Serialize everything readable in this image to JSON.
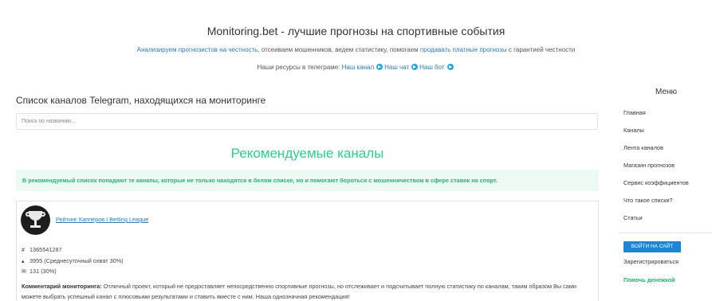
{
  "header": {
    "title": "Monitoring.bet - лучшие прогнозы на спортивные события",
    "subtitle": {
      "link1": "Анализируем прогнозистов на честность",
      "text1": ", отсеиваем мошенников, ведем статистику, помогаем ",
      "link2": "продавать платные прогнозы",
      "text2": " с гарантией честности"
    },
    "resources": {
      "label": "Наши ресурсы в телеграме:",
      "channel": "Наш канал",
      "chat": "Наш чат",
      "bot": "Наш бот"
    }
  },
  "main": {
    "page_title": "Список каналов Telegram, находящихся на мониторинге",
    "search_placeholder": "Поиск по названию...",
    "recommended_heading": "Рекомендуемые каналы",
    "alert_text": "В рекомендуемый список попадают те каналы, которые не только находятся в белом списке, но и помогают бороться с мошенничеством в сфере ставок на спорт.",
    "card": {
      "channel_name": "Рейтинг Капперов I Betting League",
      "stat_id": "1365541287",
      "stat_reach": "3955 (Среднесуточный охват 30%)",
      "stat_posts": "131 (30%)",
      "comment_label": "Комментарий мониторинга:",
      "comment_text": " Отличный проект, который не предоставляет непосредственно спортивные прогнозы, но отслеживает и подсчитывает полную статистику по каналам, таким образом Вы сами можете выбрать успешный канал с плюсовыми результатами и ставить вместе с ним. Наша однозначная рекомендация!"
    }
  },
  "sidebar": {
    "title": "Меню",
    "items": [
      {
        "label": "Главная"
      },
      {
        "label": "Каналы"
      },
      {
        "label": "Лента каналов"
      },
      {
        "label": "Магазин прогнозов"
      },
      {
        "label": "Сервис коэффициентов"
      },
      {
        "label": "Что такое списки?"
      },
      {
        "label": "Статьи"
      }
    ],
    "login_button": "ВОЙТИ НА САЙТ",
    "register_link": "Зарегистрироваться",
    "help_link": "Помочь денежкой"
  },
  "icons": {
    "telegram": "telegram-icon",
    "stat_id": "hash-icon",
    "stat_reach": "eye-icon",
    "stat_posts": "envelope-icon",
    "avatar": "trophy-icon"
  },
  "colors": {
    "link": "#2a7ab8",
    "accent_green": "#2dcf8b",
    "alert_bg": "#ecfaf3",
    "button_blue": "#1b86d3"
  }
}
